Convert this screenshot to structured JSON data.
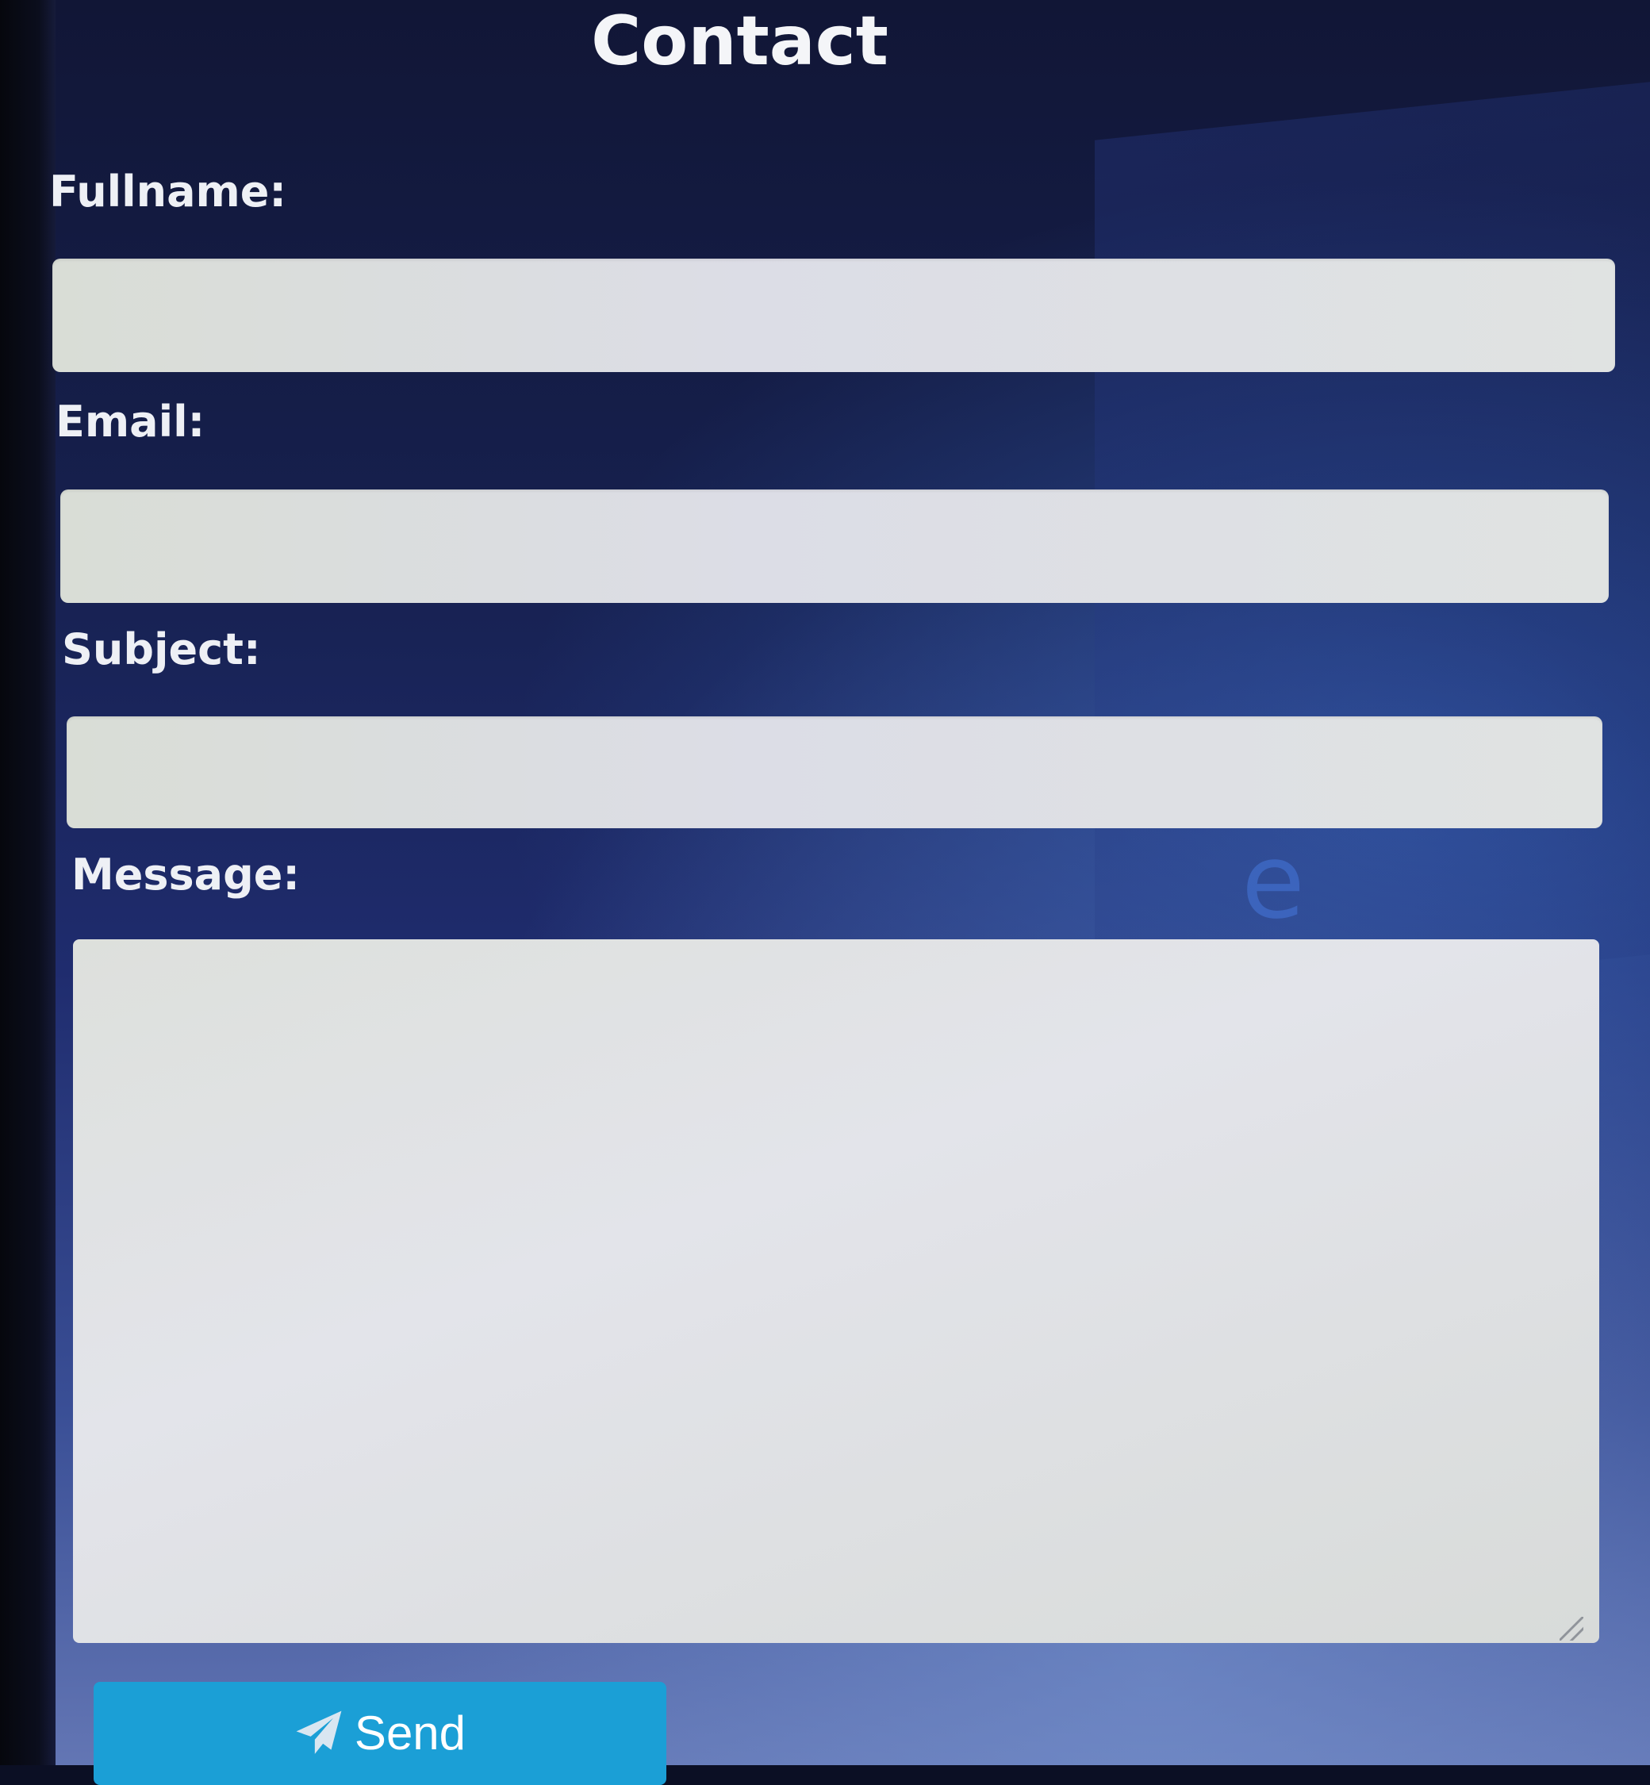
{
  "form": {
    "title": "Contact",
    "fields": {
      "fullname": {
        "label": "Fullname:",
        "value": ""
      },
      "email": {
        "label": "Email:",
        "value": ""
      },
      "subject": {
        "label": "Subject:",
        "value": ""
      },
      "message": {
        "label": "Message:",
        "value": ""
      }
    },
    "submit": {
      "label": "Send",
      "icon": "paper-plane-icon"
    }
  },
  "colors": {
    "button": "#1b9fd6",
    "background": "#16204e",
    "field": "#dcdde2",
    "label": "#eef0f5"
  }
}
